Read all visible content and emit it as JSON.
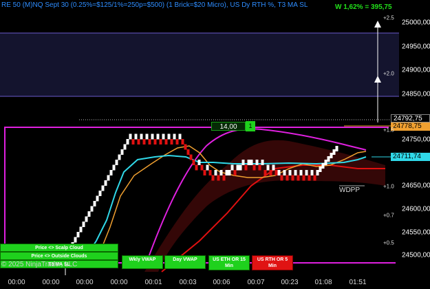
{
  "header": {
    "title": "RE 50 (M)NQ Sept 30 (0.25%=$125/1%=250p=$500)  (1 Brick=$20 Micro), US Dy RTH %, T3 MA SL",
    "performance": "W 1,62% = 395,75"
  },
  "price_axis": {
    "labels": [
      "25000,00",
      "24950,00",
      "24900,00",
      "24850,00",
      "24750,00",
      "24650,00",
      "24600,00",
      "24550,00",
      "24500,00"
    ],
    "current_price": "24792,75",
    "level_orange": "24778,75",
    "level_cyan": "24711,74",
    "multipliers": [
      "+2.5",
      "+2.0",
      "+1.5",
      "+1.0",
      "+0.7",
      "+0.5"
    ]
  },
  "time_axis": {
    "labels": [
      "00:00",
      "00:00",
      "00:00",
      "00:00",
      "00:01",
      "00:03",
      "00:06",
      "00:07",
      "00:23",
      "01:08",
      "01:51"
    ]
  },
  "panel_buttons": {
    "scalp_cloud": "Price <> Scalp Cloud",
    "outside_clouds": "Price <> Outside Clouds",
    "t3_ma_sl": "T3 MA SL",
    "wkly_vwap": "Wkly VWAP",
    "day_vwap": "Day VWAP",
    "us_eth": "US ETH OR 15 Min",
    "us_rth": "US RTH OR 5 Min"
  },
  "trade_marker": {
    "value": "14,00",
    "qty": "1"
  },
  "wdpp_label": "WDPP",
  "copyright": "© 2025 NinjaTrader, LLC",
  "colors": {
    "background": "#000000",
    "title_blue": "#2e8dff",
    "performance_green": "#22e01a",
    "magenta": "#e020e0",
    "cyan": "#30d8e8",
    "orange": "#f0a030",
    "red": "#e01010",
    "zone_fill": "#1c1a3a",
    "button_green": "#1fd11d",
    "button_red": "#e01313"
  }
}
